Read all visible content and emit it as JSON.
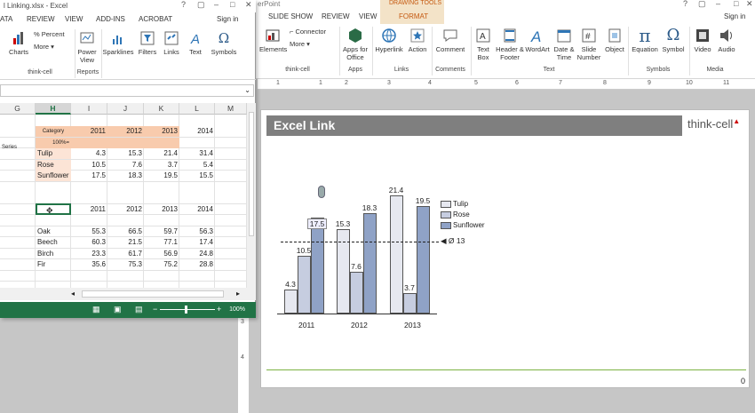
{
  "powerpoint": {
    "title": "erPoint",
    "tabs": [
      "SLIDE SHOW",
      "REVIEW",
      "VIEW"
    ],
    "contextual_tab": "DRAWING TOOLS",
    "format_tab": "FORMAT",
    "sign_in": "Sign in",
    "ribbon": {
      "elements": "Elements",
      "connector": "Connector",
      "more": "More",
      "thinkcell": "think-cell",
      "apps_for_office": "Apps for Office",
      "hyperlink": "Hyperlink",
      "action": "Action",
      "comment": "Comment",
      "text_box": "Text Box",
      "header_footer": "Header & Footer",
      "wordart": "WordArt",
      "date_time": "Date & Time",
      "slide_number": "Slide Number",
      "object": "Object",
      "equation": "Equation",
      "symbol": "Symbol",
      "video": "Video",
      "audio": "Audio",
      "groups": {
        "thinkcell": "think-cell",
        "apps": "Apps",
        "links": "Links",
        "comments": "Comments",
        "text": "Text",
        "symbols": "Symbols",
        "media": "Media"
      }
    },
    "ruler_numbers": [
      "1",
      "1",
      "2",
      "3",
      "4",
      "5",
      "6",
      "7",
      "8",
      "9",
      "10",
      "11"
    ],
    "vruler_numbers": [
      "3",
      "4"
    ],
    "slide": {
      "title": "Excel Link",
      "logo": "think-cell",
      "page_number": "0"
    }
  },
  "chart_data": {
    "type": "bar",
    "categories": [
      "2011",
      "2012",
      "2013"
    ],
    "series": [
      {
        "name": "Tulip",
        "values": [
          4.3,
          15.3,
          21.4
        ],
        "color": "#e6e8f0"
      },
      {
        "name": "Rose",
        "values": [
          10.5,
          7.6,
          3.7
        ],
        "color": "#c6cde0"
      },
      {
        "name": "Sunflower",
        "values": [
          17.5,
          18.3,
          19.5
        ],
        "color": "#8fa2c6"
      }
    ],
    "average_line": {
      "label": "Ø 13",
      "value": 13
    },
    "legend": "right"
  },
  "excel": {
    "title": "l Linking.xlsx - Excel",
    "tabs": [
      "ATA",
      "REVIEW",
      "VIEW",
      "ADD-INS",
      "ACROBAT"
    ],
    "sign_in": "Sign in",
    "ribbon": {
      "charts": "Charts",
      "percent": "% Percent",
      "more": "More",
      "thinkcell": "think-cell",
      "power_view": "Power View",
      "sparklines": "Sparklines",
      "filters": "Filters",
      "links": "Links",
      "text": "Text",
      "symbols": "Symbols",
      "reports": "Reports"
    },
    "columns": [
      "G",
      "H",
      "I",
      "J",
      "K",
      "L",
      "M"
    ],
    "selected_column": "H",
    "table1": {
      "header_label": "Category",
      "pct_label": "100%=",
      "series_label": "Series",
      "years": [
        "2011",
        "2012",
        "2013",
        "2014"
      ],
      "rows": [
        {
          "name": "Tulip",
          "values": [
            "4.3",
            "15.3",
            "21.4",
            "31.4"
          ]
        },
        {
          "name": "Rose",
          "values": [
            "10.5",
            "7.6",
            "3.7",
            "5.4"
          ]
        },
        {
          "name": "Sunflower",
          "values": [
            "17.5",
            "18.3",
            "19.5",
            "15.5"
          ]
        }
      ]
    },
    "table2": {
      "years": [
        "2011",
        "2012",
        "2013",
        "2014"
      ],
      "rows": [
        {
          "name": "Oak",
          "values": [
            "55.3",
            "66.5",
            "59.7",
            "56.3"
          ]
        },
        {
          "name": "Beech",
          "values": [
            "60.3",
            "21.5",
            "77.1",
            "17.4"
          ]
        },
        {
          "name": "Birch",
          "values": [
            "23.3",
            "61.7",
            "56.9",
            "24.8"
          ]
        },
        {
          "name": "Fir",
          "values": [
            "35.6",
            "75.3",
            "75.2",
            "28.8"
          ]
        }
      ]
    },
    "zoom": "100%"
  }
}
